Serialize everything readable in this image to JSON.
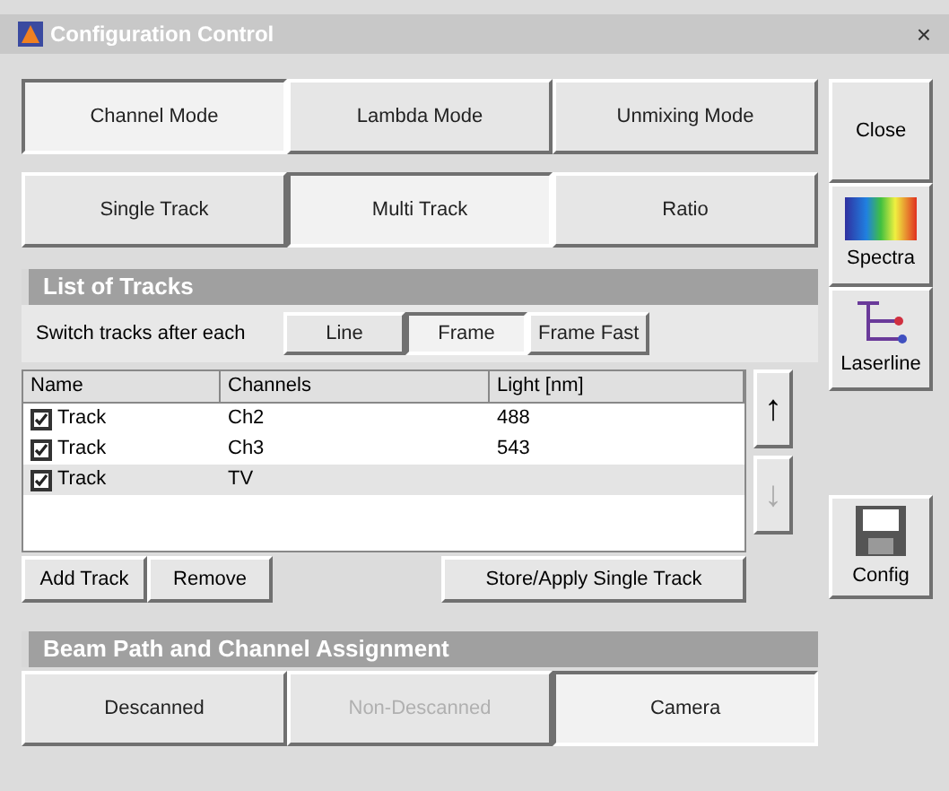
{
  "window": {
    "title": "Configuration Control",
    "close": "×"
  },
  "modes": [
    {
      "label": "Channel Mode",
      "selected": true
    },
    {
      "label": "Lambda Mode",
      "selected": false
    },
    {
      "label": "Unmixing Mode",
      "selected": false
    }
  ],
  "track_modes": [
    {
      "label": "Single Track",
      "selected": false
    },
    {
      "label": "Multi Track",
      "selected": true
    },
    {
      "label": "Ratio",
      "selected": false
    }
  ],
  "list_of_tracks": {
    "title": "List of Tracks",
    "switch_label": "Switch tracks after each",
    "switch_options": [
      {
        "label": "Line",
        "selected": false
      },
      {
        "label": "Frame",
        "selected": true
      },
      {
        "label": "Frame Fast",
        "selected": false
      }
    ],
    "columns": [
      "Name",
      "Channels",
      "Light [nm]"
    ],
    "rows": [
      {
        "checked": true,
        "name": "Track",
        "channels": "Ch2",
        "light": "488",
        "selected": false
      },
      {
        "checked": true,
        "name": "Track",
        "channels": "Ch3",
        "light": "543",
        "selected": false
      },
      {
        "checked": true,
        "name": "Track",
        "channels": "TV",
        "light": "",
        "selected": true
      }
    ],
    "move_up": {
      "label": "↑",
      "disabled": false
    },
    "move_down": {
      "label": "↓",
      "disabled": true
    },
    "buttons": [
      "Add Track",
      "Remove",
      "Store/Apply Single Track"
    ]
  },
  "beam_path": {
    "title": "Beam Path and Channel Assignment",
    "options": [
      {
        "label": "Descanned",
        "selected": false,
        "disabled": false
      },
      {
        "label": "Non-Descanned",
        "selected": false,
        "disabled": true
      },
      {
        "label": "Camera",
        "selected": true,
        "disabled": false
      }
    ]
  },
  "side_buttons": [
    {
      "kind": "text",
      "label": "Close"
    },
    {
      "kind": "spectra",
      "label": "Spectra"
    },
    {
      "kind": "laserline",
      "label": "Laserline"
    },
    {
      "kind": "config",
      "label": "Config"
    }
  ]
}
